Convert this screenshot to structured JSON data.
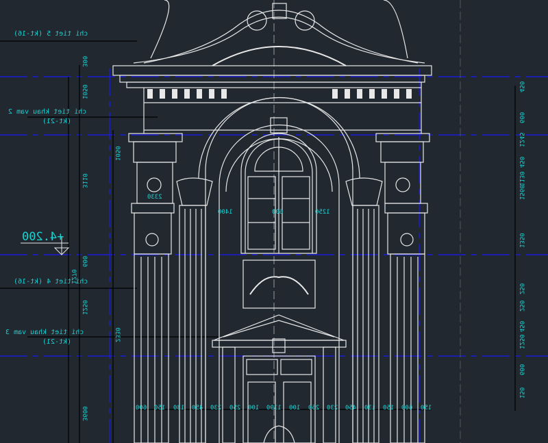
{
  "labels": {
    "detail5": "chi tiet 5 (kt-16)",
    "detail_arch2_a": "chi tiet khau vam 2",
    "detail_arch2_b": "(kt-21)",
    "detail4": "chi tiet 4 (kt-16)",
    "detail_arch3_a": "chi tiet khau vam 3",
    "detail_arch3_b": "(kt-21)",
    "level": "+4.200"
  },
  "left_dims": [
    "300",
    "1050",
    "3110",
    "600",
    "1270",
    "1250",
    "2330",
    "3600"
  ],
  "inner_dims": [
    "1050",
    "1400",
    "600",
    "1250",
    "2330"
  ],
  "bottom_dims": [
    "600",
    "150",
    "130",
    "450",
    "230",
    "250",
    "100",
    "1390",
    "100",
    "250",
    "230",
    "450",
    "130",
    "150",
    "600",
    "150"
  ],
  "right_dims": [
    "450",
    "600",
    "1245",
    "450",
    "1130",
    "1560",
    "1350",
    "250",
    "250",
    "450",
    "1250",
    "600",
    "150"
  ],
  "colors": {
    "background": "#212830",
    "lines": "#e8e8e8",
    "axis": "#1b1bd8",
    "text": "#19d3d3"
  }
}
